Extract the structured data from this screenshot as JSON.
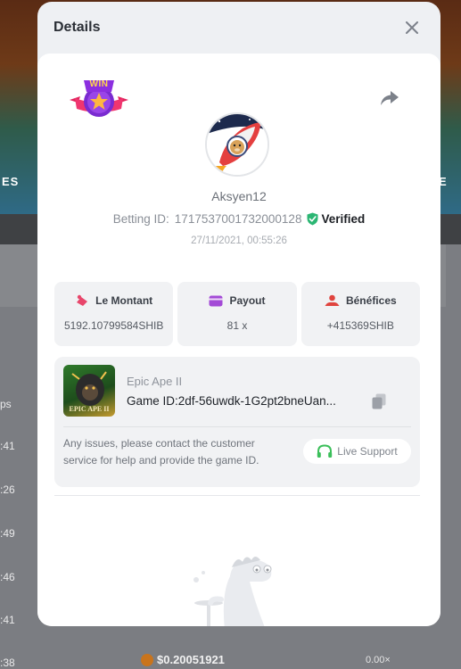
{
  "background": {
    "banner_left_label": "ES",
    "banner_right_label": "E",
    "row_labels": [
      "ps",
      ":41",
      ":26",
      ":49",
      ":46",
      ":41",
      ":38"
    ],
    "bottom_amount": "$0.20051921",
    "bottom_right": "0.00×"
  },
  "modal": {
    "title": "Details",
    "close_icon": "close-icon",
    "win_badge_text": "WIN",
    "username": "Aksyen12",
    "betting_id_label": "Betting ID:",
    "betting_id": "1717537001732000128",
    "verified_label": "Verified",
    "timestamp": "27/11/2021, 00:55:26",
    "stats": [
      {
        "label": "Le Montant",
        "value": "5192.10799584SHIB",
        "icon": "bet-amount-icon",
        "color": "#e8466b"
      },
      {
        "label": "Payout",
        "value": "81 x",
        "icon": "wallet-icon",
        "color": "#a34ad6"
      },
      {
        "label": "Bénéfices",
        "value": "+415369SHIB",
        "icon": "profit-icon",
        "color": "#e0443e"
      }
    ],
    "game": {
      "name": "Epic Ape II",
      "thumb_label": "EPIC APE II",
      "id_label": "Game ID:",
      "id_value": "2df-56uwdk-1G2pt2bneUan..."
    },
    "notice": "Any issues, please contact the customer service for help and provide the game ID.",
    "live_support_label": "Live Support"
  },
  "colors": {
    "verified_green": "#2bb673",
    "live_support_green": "#3bbf5a",
    "modal_bg": "#eef0f3",
    "card_bg": "#ffffff"
  }
}
